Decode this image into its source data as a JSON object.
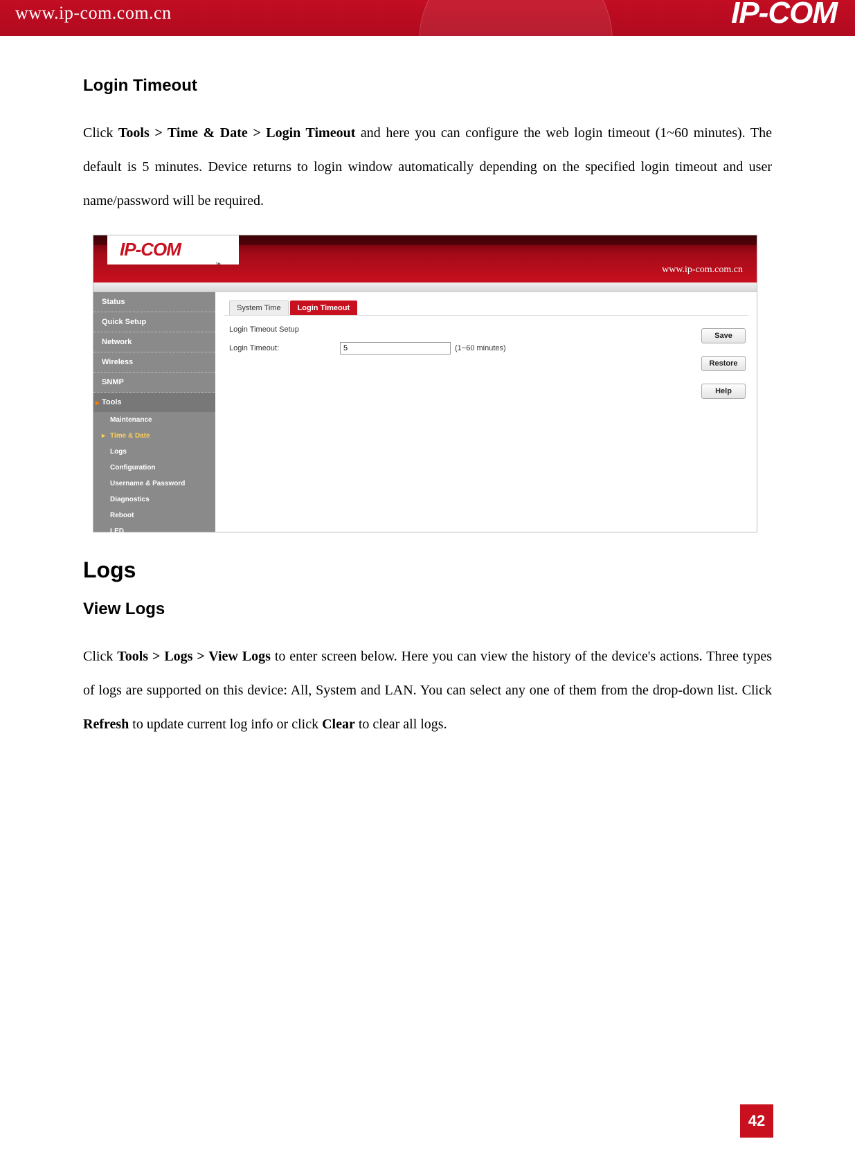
{
  "banner": {
    "url": "www.ip-com.com.cn",
    "brand": "IP-COM"
  },
  "sec1": {
    "heading": "Login Timeout",
    "p1_prefix": "Click ",
    "p1_bold": "Tools > Time & Date > Login Timeout",
    "p1_rest": " and here you can configure the web login timeout (1~60 minutes). The default is 5 minutes. Device returns to login window automatically depending on the specified login timeout and user name/password will be required."
  },
  "shot": {
    "logo": "IP-COM",
    "logo_sub": "™",
    "url_small": "www.ip-com.com.cn",
    "nav": {
      "status": "Status",
      "quick": "Quick Setup",
      "network": "Network",
      "wireless": "Wireless",
      "snmp": "SNMP",
      "tools": "Tools",
      "sub": {
        "maintenance": "Maintenance",
        "time": "Time & Date",
        "logs": "Logs",
        "config": "Configuration",
        "userpass": "Username & Password",
        "diag": "Diagnostics",
        "reboot": "Reboot",
        "led": "LED"
      }
    },
    "tabs": {
      "t1": "System Time",
      "t2": "Login Timeout"
    },
    "form": {
      "section": "Login Timeout Setup",
      "label": "Login Timeout:",
      "value": "5",
      "hint": "(1~60 minutes)"
    },
    "buttons": {
      "save": "Save",
      "restore": "Restore",
      "help": "Help"
    }
  },
  "sec2": {
    "heading_big": "Logs",
    "subheading": "View Logs",
    "p2_prefix": "Click ",
    "p2_bold1": "Tools > Logs > View Logs",
    "p2_mid": " to enter screen below. Here you can view the history of the device's actions. Three types of logs are supported on this device: All, System and LAN. You can select any one of them from the drop-down list. Click ",
    "p2_bold2": "Refresh",
    "p2_mid2": " to update current log info or click ",
    "p2_bold3": "Clear",
    "p2_end": " to clear all logs."
  },
  "page_number": "42"
}
